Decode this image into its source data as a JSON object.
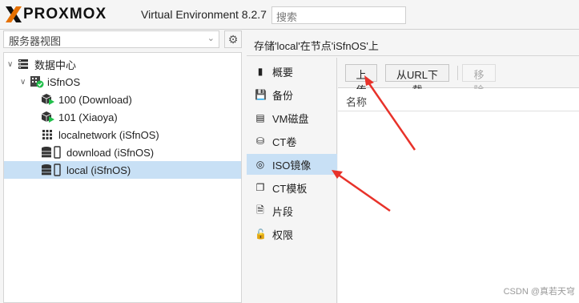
{
  "topbar": {
    "logo_text": "PROXMOX",
    "version": "Virtual Environment 8.2.7",
    "search_placeholder": "搜索"
  },
  "left": {
    "view_select": "服务器视图",
    "tree": [
      {
        "label": "数据中心",
        "icon": "datacenter-icon"
      },
      {
        "label": "iSfnOS",
        "icon": "node-online-icon"
      },
      {
        "label": "100 (Download)",
        "icon": "vm-running-icon"
      },
      {
        "label": "101 (Xiaoya)",
        "icon": "vm-running-icon"
      },
      {
        "label": "localnetwork (iSfnOS)",
        "icon": "network-grid-icon"
      },
      {
        "label": "download (iSfnOS)",
        "icon": "storage-icon"
      },
      {
        "label": "local (iSfnOS)",
        "icon": "storage-icon"
      }
    ]
  },
  "header": {
    "title": "存储'local'在节点'iSfnOS'上"
  },
  "menu": [
    {
      "label": "概要",
      "icon": "book-icon"
    },
    {
      "label": "备份",
      "icon": "floppy-icon"
    },
    {
      "label": "VM磁盘",
      "icon": "hdd-icon"
    },
    {
      "label": "CT卷",
      "icon": "ct-volume-icon"
    },
    {
      "label": "ISO镜像",
      "icon": "disc-icon"
    },
    {
      "label": "CT模板",
      "icon": "template-icon"
    },
    {
      "label": "片段",
      "icon": "snippet-icon"
    },
    {
      "label": "权限",
      "icon": "unlock-icon"
    }
  ],
  "toolbar": {
    "upload": "上传",
    "download_url": "从URL下载",
    "remove": "移除"
  },
  "grid": {
    "col_name": "名称"
  },
  "watermark": "CSDN @真若天穹",
  "colors": {
    "selection": "#c8e0f5",
    "logo_orange": "#e57000",
    "annotation_red": "#e8322a",
    "status_green": "#21bf4b"
  }
}
